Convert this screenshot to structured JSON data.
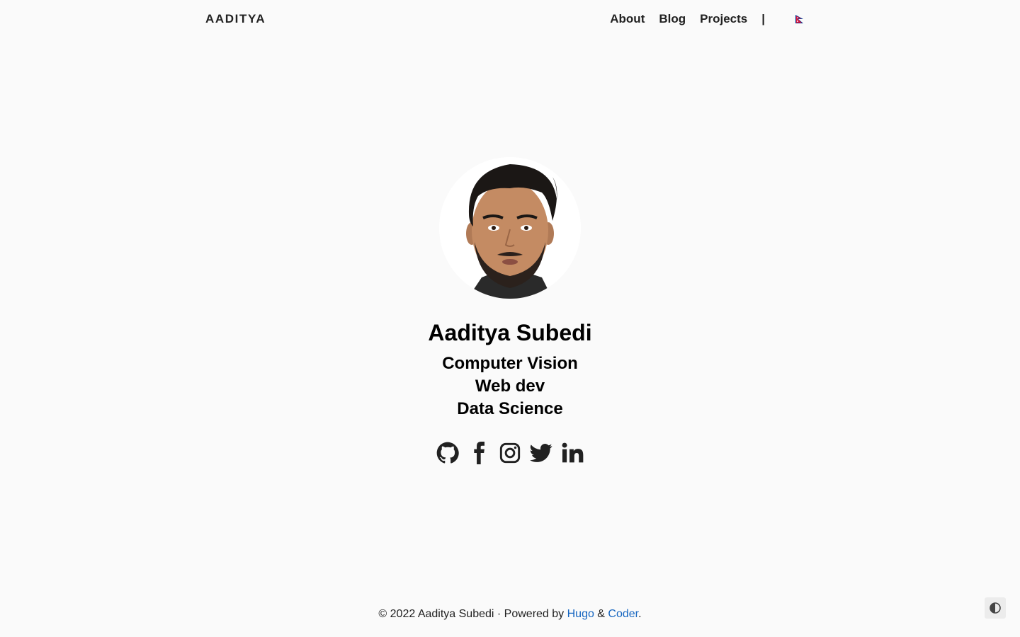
{
  "nav": {
    "brand": "AADITYA",
    "links": [
      "About",
      "Blog",
      "Projects"
    ],
    "separator": "|",
    "language_flag": "nepal-flag-icon"
  },
  "profile": {
    "name": "Aaditya Subedi",
    "roles": [
      "Computer Vision",
      "Web dev",
      "Data Science"
    ],
    "avatar_icon": "profile-photo"
  },
  "social": [
    "github-icon",
    "facebook-icon",
    "instagram-icon",
    "twitter-icon",
    "linkedin-icon"
  ],
  "footer": {
    "prefix": "© 2022 Aaditya Subedi · Powered by ",
    "hugo": "Hugo",
    "amp": " & ",
    "coder": "Coder",
    "suffix": "."
  },
  "colors": {
    "background": "#fafafa",
    "text": "#212121",
    "link": "#1565c0",
    "flag_red": "#dc143c",
    "flag_blue": "#003893"
  }
}
